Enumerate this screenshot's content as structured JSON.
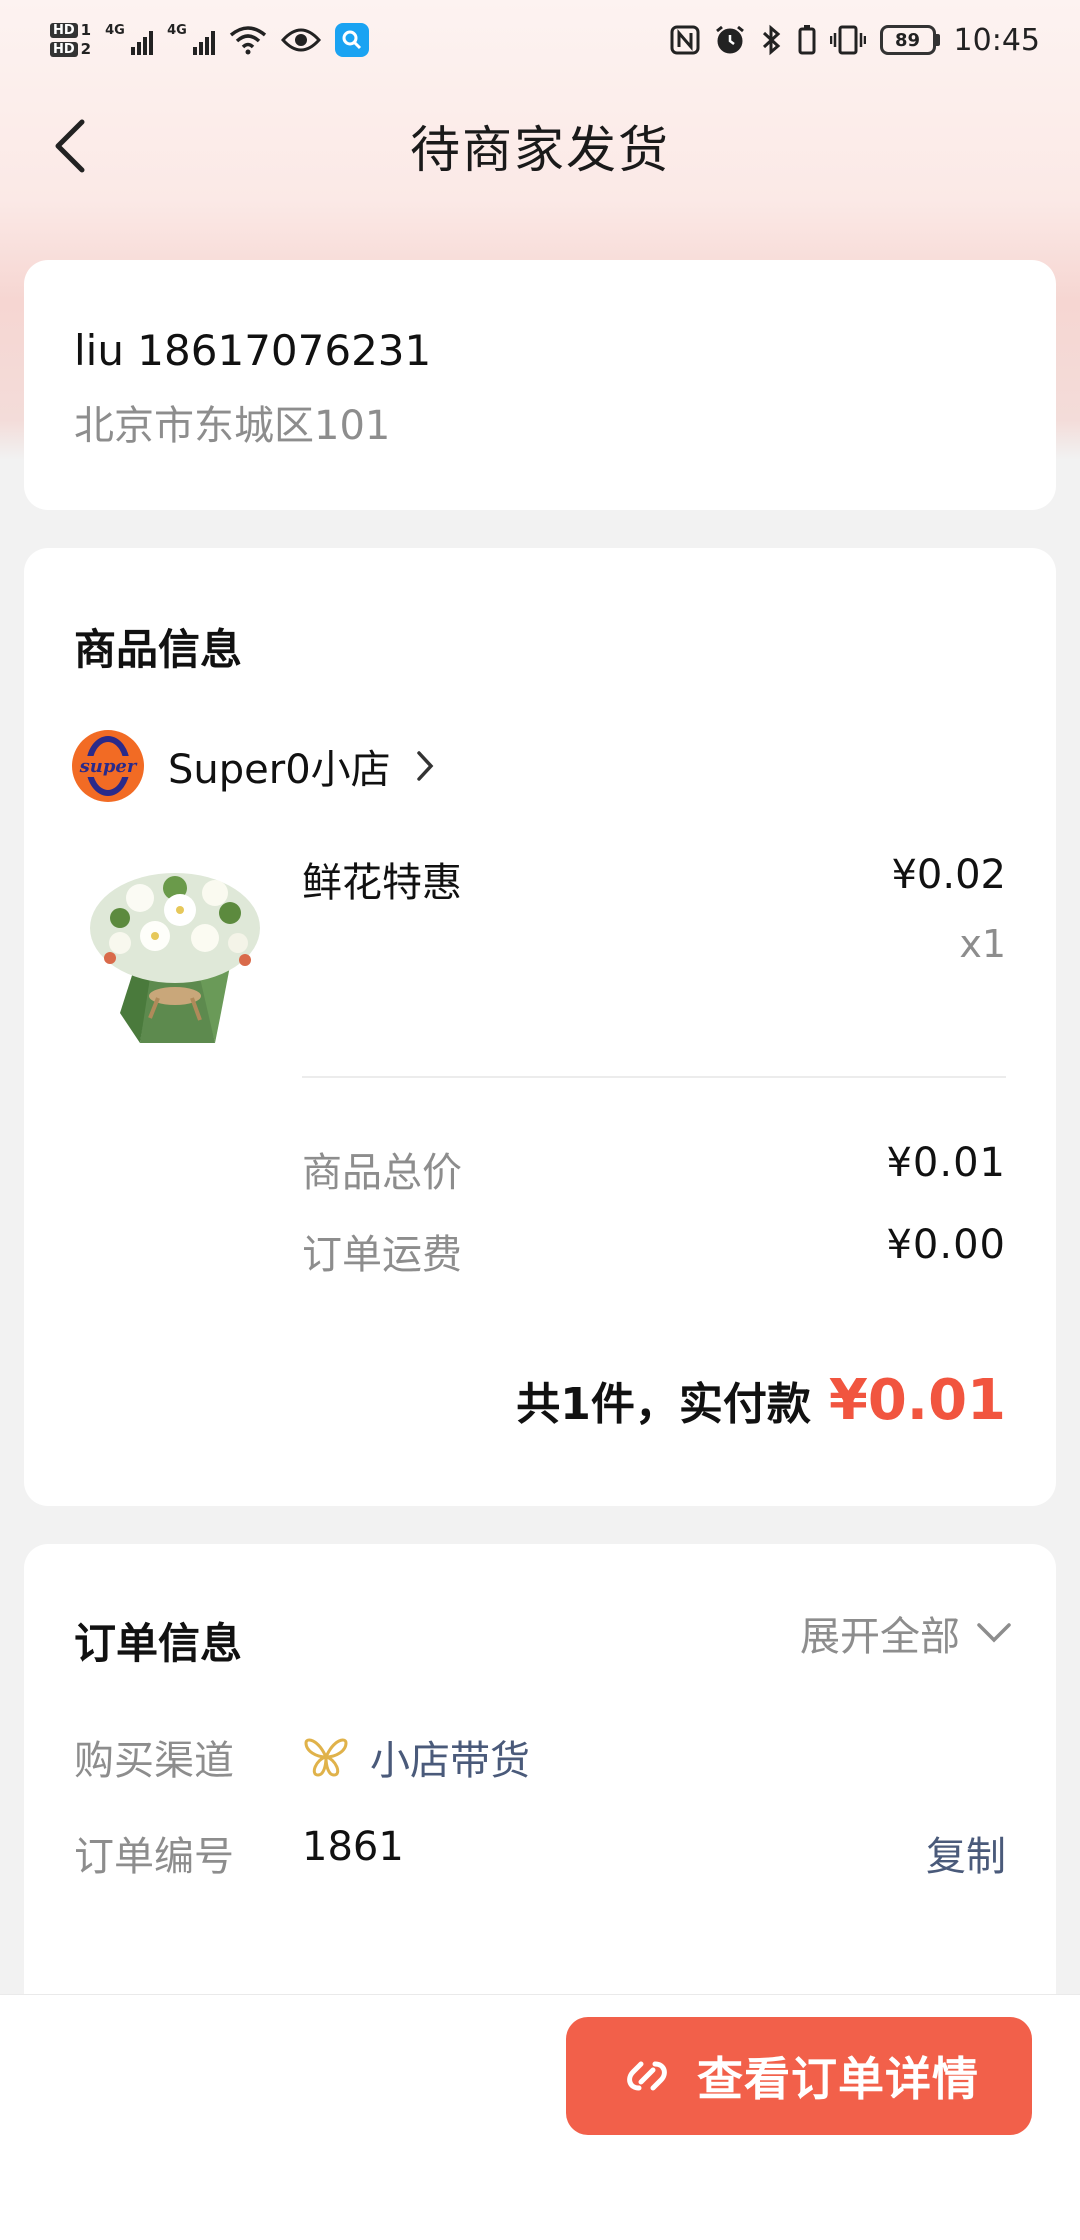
{
  "status_bar": {
    "hd_labels": [
      "HD",
      "HD"
    ],
    "hd_numbers": [
      "1",
      "2"
    ],
    "network_labels": [
      "4G",
      "4G"
    ],
    "battery_level": "89",
    "time": "10:45"
  },
  "header": {
    "title": "待商家发货"
  },
  "address": {
    "name_phone": "liu 18617076231",
    "address": "北京市东城区101"
  },
  "goods": {
    "section_title": "商品信息",
    "shop_name": "Super0小店",
    "shop_logo_text": "super",
    "product_name": "鲜花特惠",
    "product_price": "¥0.02",
    "product_qty": "x1",
    "subtotal_label": "商品总价",
    "subtotal_value": "¥0.01",
    "shipping_label": "订单运费",
    "shipping_value": "¥0.00",
    "total_text": "共1件，实付款",
    "total_amount": "¥0.01"
  },
  "order": {
    "section_title": "订单信息",
    "expand_label": "展开全部",
    "channel_label": "购买渠道",
    "channel_value": "小店带货",
    "order_no_label": "订单编号",
    "order_no_value": "1861",
    "copy_label": "复制"
  },
  "bottom_bar": {
    "detail_button_label": "查看订单详情"
  },
  "colors": {
    "accent_red": "#f2604a",
    "price_red": "#f1553f",
    "link_blue": "#4a5a7a",
    "muted_gray": "#8d8d8d"
  }
}
